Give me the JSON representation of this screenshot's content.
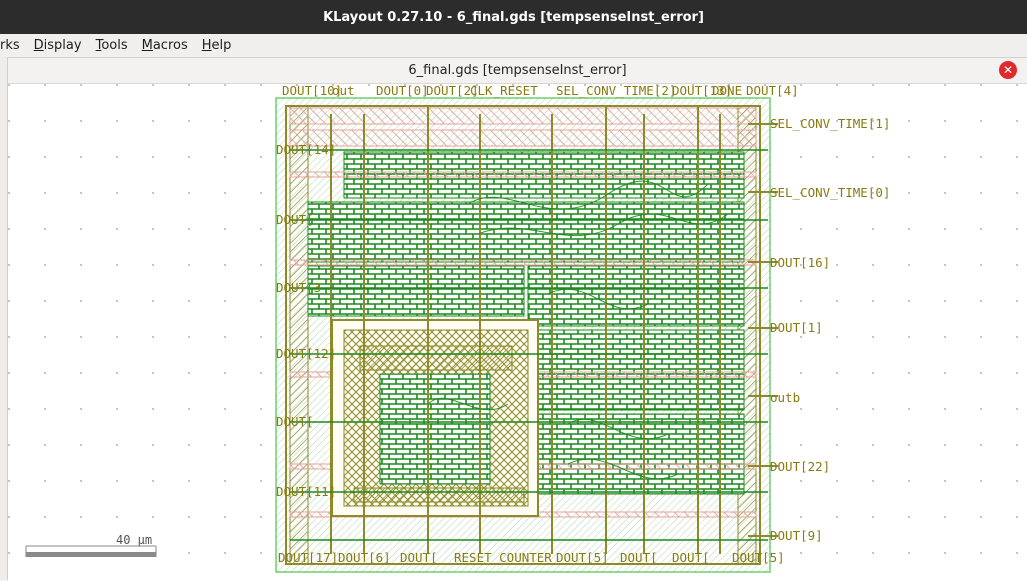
{
  "window": {
    "title": "KLayout 0.27.10 - 6_final.gds [tempsenseInst_error]"
  },
  "menu": {
    "items": [
      {
        "label": "rks",
        "key": ""
      },
      {
        "label": "Display",
        "key": "D"
      },
      {
        "label": "Tools",
        "key": "T"
      },
      {
        "label": "Macros",
        "key": "M"
      },
      {
        "label": "Help",
        "key": "H"
      }
    ]
  },
  "document": {
    "tab_title": "6_final.gds [tempsenseInst_error]",
    "close_icon": "close-icon"
  },
  "layout": {
    "pins_top": [
      "DOUT[10]",
      "out",
      "DOUT[0]",
      "DOUT[2]",
      "CLK_RESET",
      "SEL_CONV_TIME[2]",
      "DOUT[13]",
      "DONE",
      "DOUT[4]"
    ],
    "pins_right": [
      "SEL_CONV_TIME[1]",
      "SEL_CONV_TIME[0]",
      "DOUT[16]",
      "DOUT[1]",
      "outb",
      "DOUT[22]",
      "DOUT[9]"
    ],
    "pins_left": [
      "DOUT[14]",
      "DOUT[",
      "DOUT[3",
      "DOUT[12]",
      "DOUT[",
      "DOUT[11]"
    ],
    "pins_bottom": [
      "DOUT[17]",
      "DOUT[6]",
      "DOUT[",
      "RESET_COUNTER",
      "DOUT[5]",
      "DOUT[",
      "DOUT[",
      "DOUT[5]"
    ],
    "colors": {
      "pin_label": "#8a7a12",
      "metal_green": "#1c8a1c",
      "poly_red": "#e6a09a",
      "diff_olive": "#8d8a2a"
    }
  },
  "scale": {
    "label": "40 µm"
  }
}
